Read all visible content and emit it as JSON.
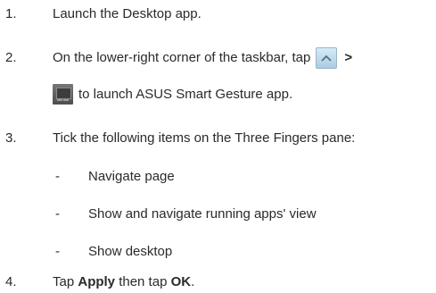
{
  "steps": [
    {
      "number": "1.",
      "text": "Launch the Desktop app."
    },
    {
      "number": "2.",
      "text_before": "On the lower-right corner of the taskbar, tap",
      "separator": ">",
      "text_after": "to launch ASUS Smart Gesture app."
    },
    {
      "number": "3.",
      "text": "Tick the following items on the Three Fingers pane:"
    },
    {
      "number": "4.",
      "text_prefix": "Tap ",
      "apply": "Apply",
      "text_middle": " then tap ",
      "ok": "OK",
      "text_suffix": "."
    }
  ],
  "sub_items": [
    {
      "bullet": "-",
      "text": "Navigate page"
    },
    {
      "bullet": "-",
      "text": "Show and navigate running apps' view"
    },
    {
      "bullet": "-",
      "text": "Show desktop"
    }
  ],
  "icons": {
    "taskbar_chevron": "chevron-up-icon",
    "gesture_app": "touchpad-gesture-icon"
  },
  "colors": {
    "text": "#2a2a2a",
    "chevron_button": "#bfdcef"
  }
}
